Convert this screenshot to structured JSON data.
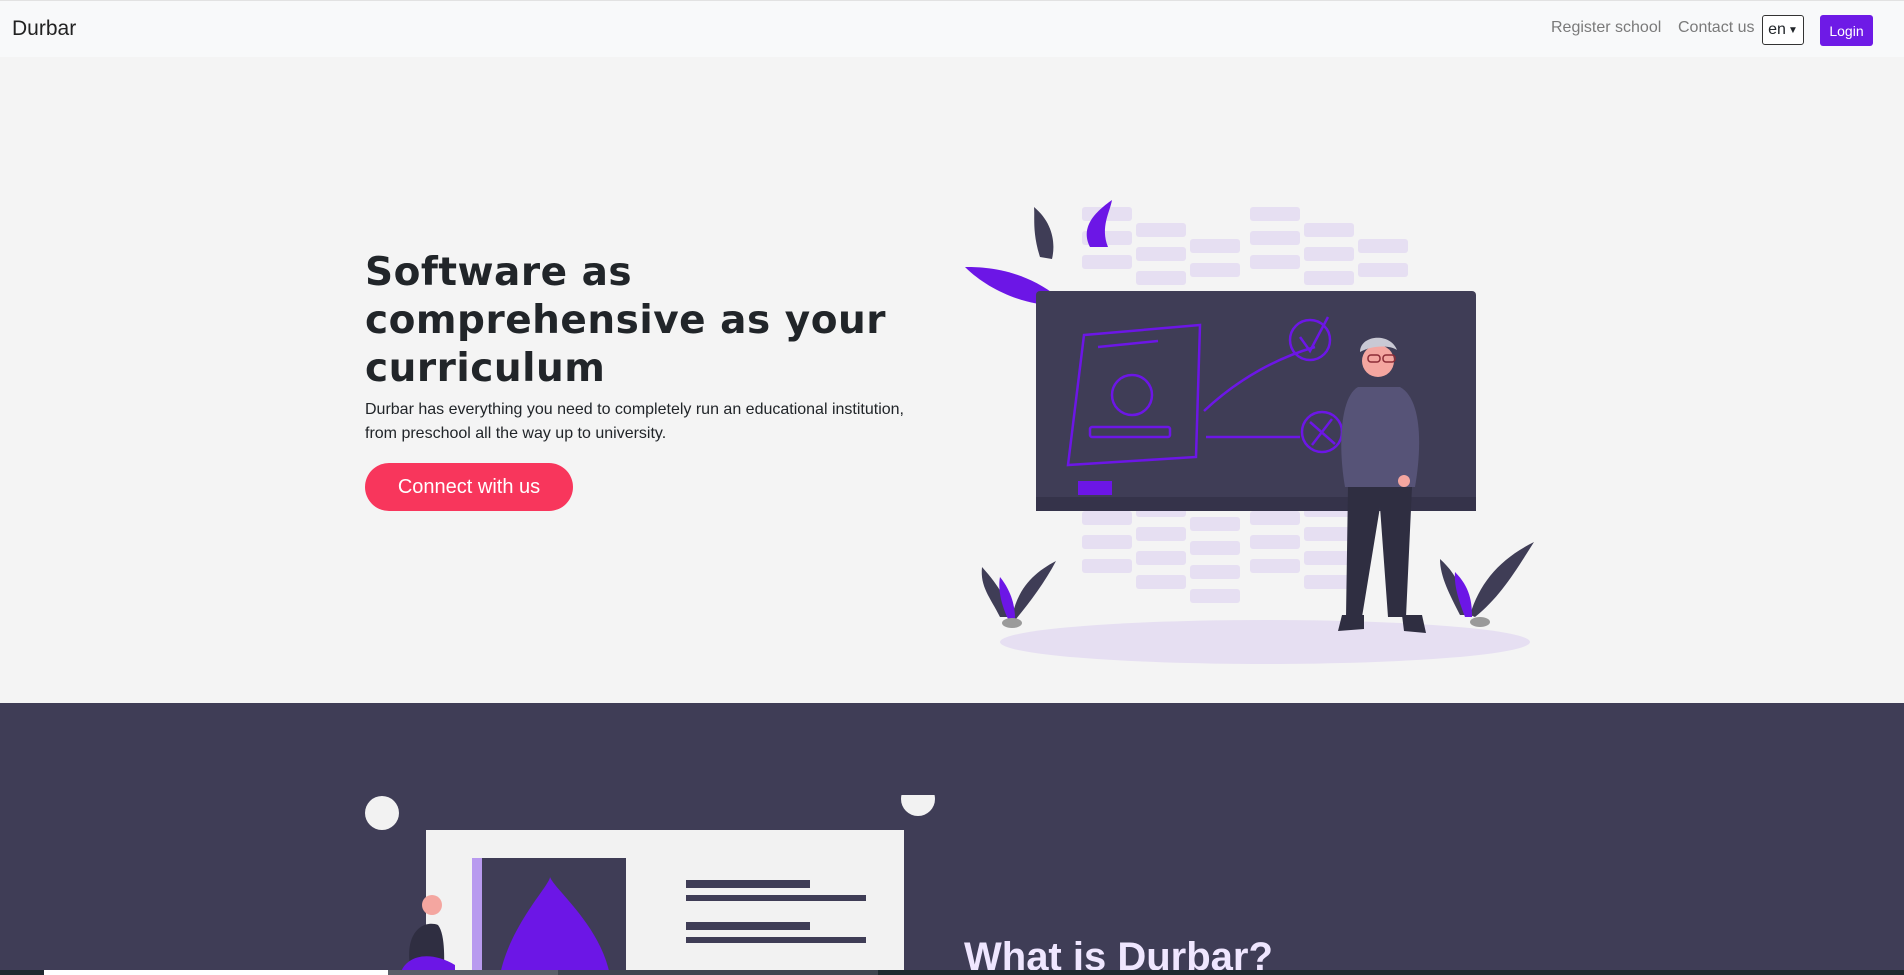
{
  "navbar": {
    "brand": "Durbar",
    "links": {
      "register": "Register school",
      "contact": "Contact us"
    },
    "language": {
      "selected": "en"
    },
    "login_label": "Login"
  },
  "hero": {
    "title": "Software as comprehensive as your curriculum",
    "description": "Durbar has everything you need to completely run an educational institution, from preschool all the way up to university.",
    "cta_label": "Connect with us"
  },
  "about": {
    "title": "What is Durbar?"
  },
  "colors": {
    "accent": "#6e1ae6",
    "cta": "#f8365c",
    "dark_section": "#3f3d56"
  },
  "icons": {
    "language_dropdown": "chevron-down-icon"
  }
}
